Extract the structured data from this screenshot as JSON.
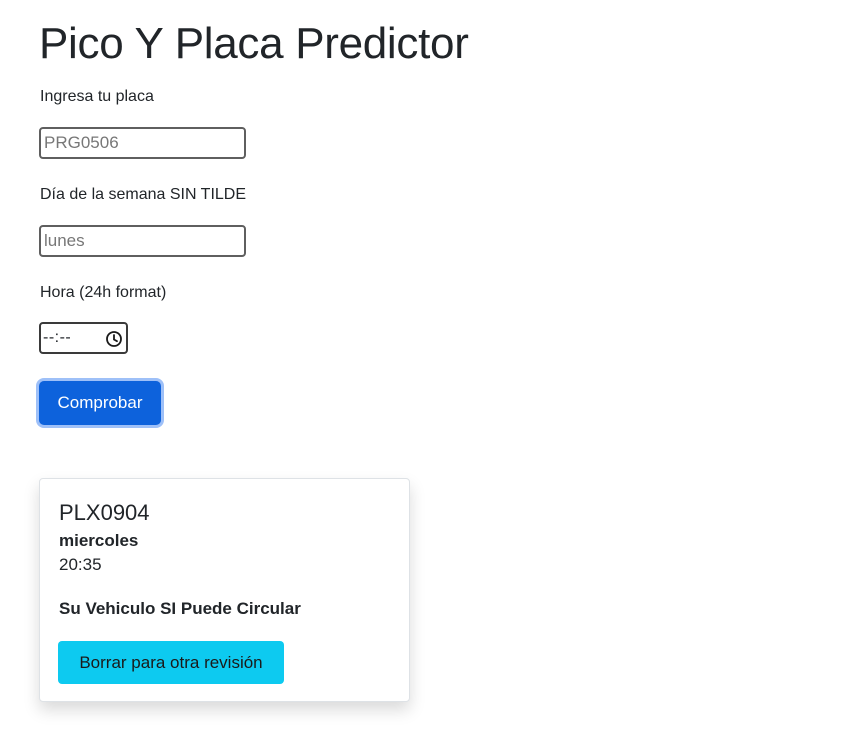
{
  "page": {
    "title": "Pico Y Placa Predictor"
  },
  "form": {
    "plate_label": "Ingresa tu placa",
    "plate_placeholder": "PRG0506",
    "plate_value": "",
    "day_label": "Día de la semana SIN TILDE",
    "day_placeholder": "lunes",
    "day_value": "",
    "hour_label": "Hora (24h format)",
    "hour_value": "--:--",
    "hour_icon": "clock-icon",
    "submit_label": "Comprobar"
  },
  "result": {
    "plate": "PLX0904",
    "day": "miercoles",
    "time": "20:35",
    "message": "Su Vehiculo SI Puede Circular",
    "reset_label": "Borrar para otra revisión"
  },
  "colors": {
    "primary": "#0d62dc",
    "primary_focus_ring": "#9ec0f8",
    "info": "#0dcaf0",
    "text": "#212529"
  }
}
